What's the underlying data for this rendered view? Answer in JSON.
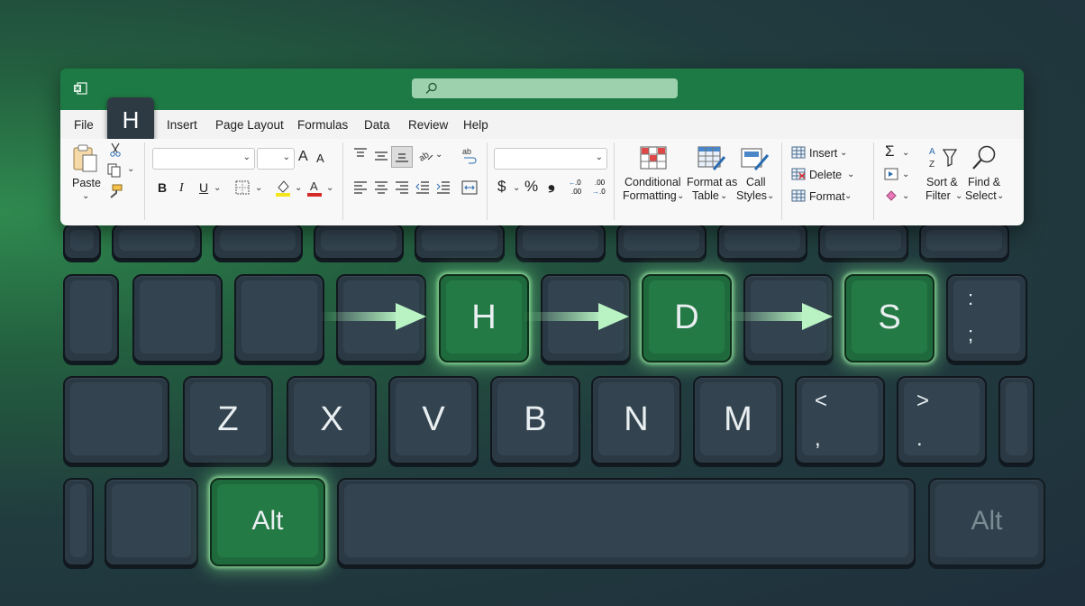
{
  "window": {
    "app_icon": "excel-icon",
    "search": {
      "icon": "search-icon",
      "placeholder": ""
    }
  },
  "tabs": [
    "File",
    "H",
    "Insert",
    "Page Layout",
    "Formulas",
    "Data",
    "Review",
    "Help"
  ],
  "ribbon": {
    "clipboard": {
      "paste": "Paste",
      "icons": [
        "paste-icon",
        "cut-icon",
        "copy-icon",
        "format-painter-icon"
      ]
    },
    "font": {
      "bold": "B",
      "italic": "I",
      "underline": "U",
      "grow": "A",
      "shrink": "A"
    },
    "number": {
      "currency": "$",
      "percent": "%",
      "comma": "❟",
      "inc": ".00",
      "dec": ".0"
    },
    "styles": {
      "conditional": [
        "Conditional",
        "Formatting"
      ],
      "format_table": [
        "Format as",
        "Table"
      ],
      "cell_styles": [
        "Call",
        "Styles"
      ]
    },
    "cells": {
      "insert": "Insert",
      "delete": "Delete",
      "format": "Format"
    },
    "editing": {
      "sort": [
        "Sort &",
        "Filter"
      ],
      "find": [
        "Find &",
        "Select"
      ],
      "sum": "Σ"
    }
  },
  "keyboard": {
    "highlighted": [
      "Alt",
      "H",
      "D",
      "S"
    ],
    "row_home": [
      "",
      "",
      "",
      "",
      "H",
      "",
      "D",
      "",
      "S"
    ],
    "row_bottom": [
      "Z",
      "X",
      "V",
      "B",
      "N",
      "M"
    ],
    "punct": {
      "semicolon_top": ":",
      "semicolon_bottom": ";",
      "comma_top": "<",
      "comma_bottom": ",",
      "period_top": ">",
      "period_bottom": "."
    },
    "alt_left": "Alt",
    "alt_right": "Alt"
  },
  "colors": {
    "accent": "#1e7a44",
    "glow": "#7fe08f",
    "key": "#2b3944"
  }
}
